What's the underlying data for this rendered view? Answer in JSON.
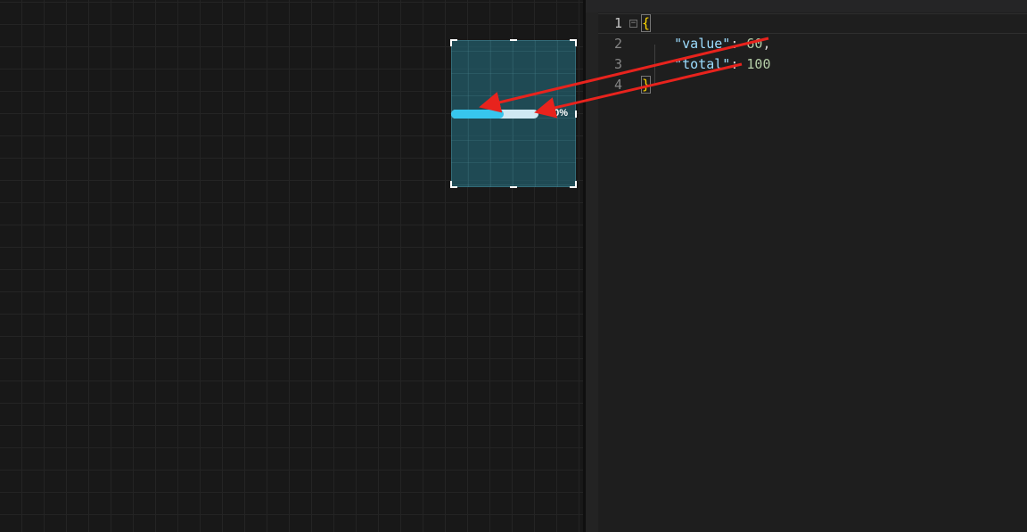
{
  "canvas": {
    "widget": {
      "type": "progress-bar",
      "progress_fraction": 0.6,
      "label": "60%",
      "fill_color": "#37c6ee",
      "track_color": "#cfe9f3",
      "selection_color": "#225e6c"
    }
  },
  "editor": {
    "lines": [
      {
        "number": "1",
        "brace": "{"
      },
      {
        "number": "2",
        "key": "\"value\"",
        "colon": ": ",
        "value": "60",
        "comma": ","
      },
      {
        "number": "3",
        "key": "\"total\"",
        "colon": ": ",
        "value": "100"
      },
      {
        "number": "4",
        "brace": "}"
      }
    ],
    "fold_marker": "−",
    "colors": {
      "key": "#9cdcfe",
      "number": "#b5cea8",
      "brace": "#ffd700",
      "arrow": "#e8231d"
    }
  },
  "annotations": {
    "arrows": [
      {
        "from": "editor.lines.1.value",
        "to": "canvas.widget.progress_fill"
      },
      {
        "from": "editor.lines.2.value",
        "to": "canvas.widget.progress_track_end"
      }
    ]
  }
}
